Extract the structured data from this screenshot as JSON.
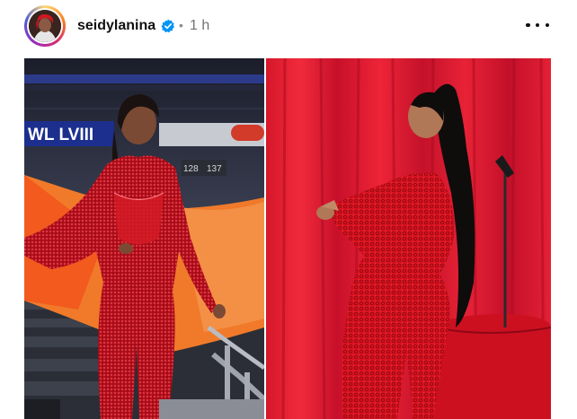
{
  "post": {
    "username": "seidylanina",
    "separator": "•",
    "time_ago": "1 h"
  },
  "icons": {
    "verified": "verified-badge-icon",
    "more": "more-options-icon",
    "avatar": "profile-avatar"
  },
  "media": {
    "left_photo": "photo-left-red-sequin-jumpsuit-stadium",
    "right_photo": "photo-right-red-lace-outfit-curtain",
    "stadium_sign_text": "WL LVIII",
    "board_numbers": [
      "128",
      "137"
    ]
  },
  "colors": {
    "verified_blue": "#0095f6",
    "text_secondary": "#737373"
  }
}
